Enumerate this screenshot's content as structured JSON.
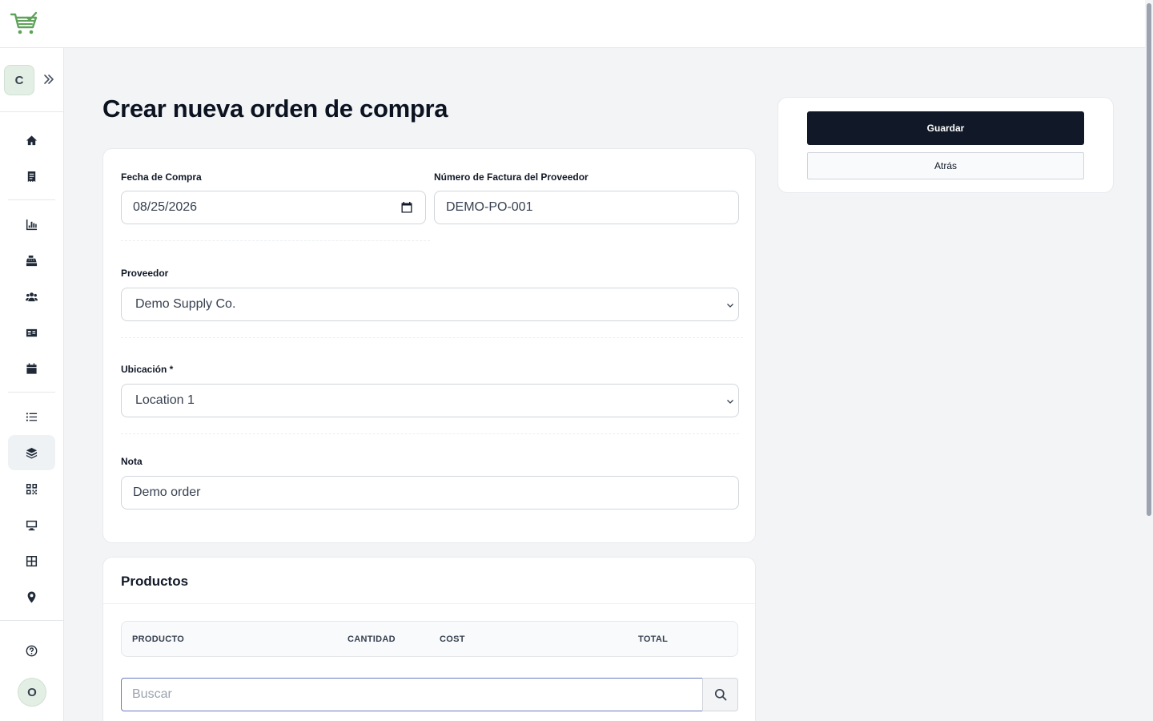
{
  "app": {
    "logo_icon": "shopping-cart-icon",
    "brand_color": "#5fa35a"
  },
  "sidebar": {
    "store_initial": "C",
    "expand_icon": "double-chevron-right-icon",
    "items": [
      {
        "icon": "home-icon",
        "active": false
      },
      {
        "icon": "receipt-icon",
        "active": false
      },
      {
        "icon": "bar-chart-icon",
        "active": false
      },
      {
        "icon": "cash-register-icon",
        "active": false
      },
      {
        "icon": "users-icon",
        "active": false
      },
      {
        "icon": "id-card-icon",
        "active": false
      },
      {
        "icon": "calendar-icon",
        "active": false
      },
      {
        "icon": "list-icon",
        "active": false
      },
      {
        "icon": "box-icon",
        "active": true
      },
      {
        "icon": "qr-code-icon",
        "active": false
      },
      {
        "icon": "monitor-icon",
        "active": false
      },
      {
        "icon": "grid-icon",
        "active": false
      },
      {
        "icon": "map-pin-icon",
        "active": false
      }
    ],
    "help_icon": "help-circle-icon",
    "user_initial": "O"
  },
  "page": {
    "title": "Crear nueva orden de compra"
  },
  "form": {
    "purchase_date": {
      "label": "Fecha de Compra",
      "value": "08/25/2026"
    },
    "invoice_number": {
      "label": "Número de Factura del Proveedor",
      "value": "DEMO-PO-001"
    },
    "supplier": {
      "label": "Proveedor",
      "value": "Demo Supply Co."
    },
    "location": {
      "label": "Ubicación *",
      "value": "Location 1"
    },
    "note": {
      "label": "Nota",
      "value": "Demo order"
    }
  },
  "actions": {
    "save_label": "Guardar",
    "back_label": "Atrás"
  },
  "products": {
    "title": "Productos",
    "columns": [
      "PRODUCTO",
      "CANTIDAD",
      "COST",
      "TOTAL"
    ],
    "search_placeholder": "Buscar"
  }
}
